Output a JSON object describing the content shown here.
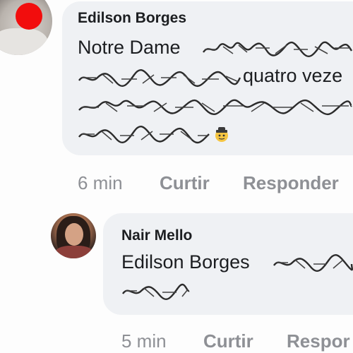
{
  "comments": [
    {
      "author": "Edilson Borges",
      "line1_visible": "Notre Dame",
      "line2_visible": "quatro veze",
      "emoji": "detective-emoji",
      "time": "6 min",
      "like_label": "Curtir",
      "reply_label": "Responder"
    }
  ],
  "replies": [
    {
      "author": "Nair Mello",
      "mention": "Edilson Borges",
      "time": "5 min",
      "like_label": "Curtir",
      "reply_label": "Respor"
    }
  ]
}
